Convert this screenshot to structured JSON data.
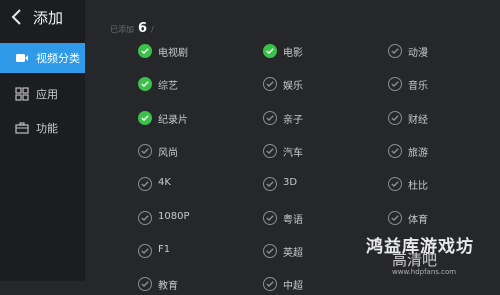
{
  "header": {
    "title": "添加"
  },
  "sidebar": {
    "items": [
      {
        "label": "视频分类",
        "icon": "video-icon",
        "active": true
      },
      {
        "label": "应用",
        "icon": "apps-grid-icon",
        "active": false
      },
      {
        "label": "功能",
        "icon": "toolbox-icon",
        "active": false
      }
    ]
  },
  "summary": {
    "prefix": "已添加",
    "count": "6",
    "suffix": "/"
  },
  "categories": {
    "col1": [
      "电视剧",
      "综艺",
      "纪录片",
      "风尚",
      "4K",
      "1080P",
      "F1",
      "教育"
    ],
    "col2": [
      "电影",
      "娱乐",
      "亲子",
      "汽车",
      "3D",
      "粤语",
      "英超",
      "中超"
    ],
    "col3": [
      "动漫",
      "音乐",
      "财经",
      "旅游",
      "杜比",
      "体育"
    ],
    "selected": [
      "电视剧",
      "电影",
      "综艺",
      "纪录片"
    ]
  },
  "watermark": {
    "main": "鸿益库游戏坊",
    "sub": "高清吧",
    "url": "www.hdpfans.com"
  },
  "colors": {
    "accent": "#2f9ae8",
    "check_selected": "#3bc04a",
    "sidebar_bg": "#1b1d20",
    "main_bg": "#25272b"
  }
}
